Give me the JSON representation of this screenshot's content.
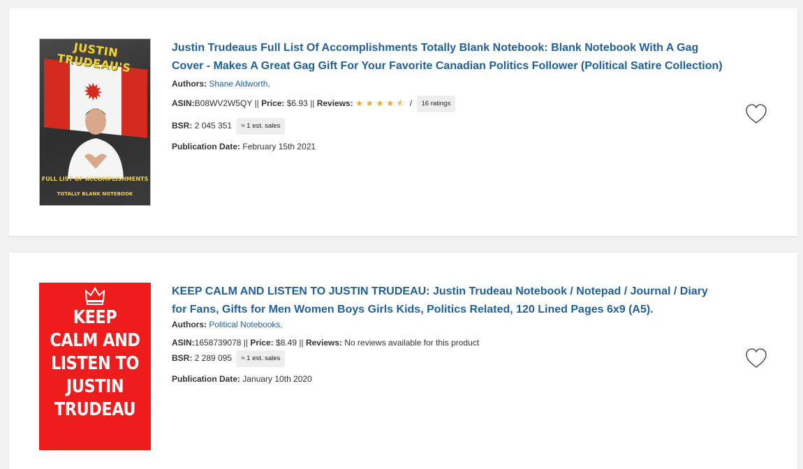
{
  "products": [
    {
      "cover_text": {
        "title": "JUSTIN TRUDEAU'S",
        "line1": "FULL LIST OF ACCOMPLISHMENTS",
        "line2": "TOTALLY BLANK NOTEBOOK"
      },
      "title": "Justin Trudeaus Full List Of Accomplishments Totally Blank Notebook: Blank Notebook With A Gag Cover - Makes A Great Gag Gift For Your Favorite Canadian Politics Follower (Political Satire Collection)",
      "authors_label": "Authors:",
      "authors": "Shane Aldworth,",
      "asin_label": "ASIN:",
      "asin": "B08WV2W5QY",
      "sep1": " || ",
      "price_label": "Price:",
      "price": "$6.93",
      "sep2": " || ",
      "reviews_label": "Reviews:",
      "rating": 4.5,
      "stars_display": "★★★★⯪",
      "slash": " /",
      "ratings_count": "16 ratings",
      "bsr_label": "BSR:",
      "bsr": "2 045 351",
      "sales_badge": "≈ 1 est. sales",
      "pub_label": "Publication Date:",
      "pub_date": "February 15th 2021"
    },
    {
      "cover_text": {
        "title": "KEEP CALM AND LISTEN TO JUSTIN TRUDEAU"
      },
      "title": "KEEP CALM AND LISTEN TO JUSTIN TRUDEAU: Justin Trudeau Notebook / Notepad / Journal / Diary for Fans, Gifts for Men Women Boys Girls Kids, Politics Related, 120 Lined Pages 6x9 (A5).",
      "authors_label": "Authors:",
      "authors": "Political Notebooks,",
      "asin_label": "ASIN:",
      "asin": "1658739078",
      "sep1": " || ",
      "price_label": "Price:",
      "price": "$8.49",
      "sep2": " || ",
      "reviews_label": "Reviews:",
      "reviews_text": "No reviews available for this product",
      "bsr_label": "BSR:",
      "bsr": "2 289 095",
      "sales_badge": "≈ 1 est. sales",
      "pub_label": "Publication Date:",
      "pub_date": "January 10th 2020"
    }
  ],
  "icons": {
    "favorite": "heart-outline-icon",
    "star": "star-icon",
    "crown": "crown-icon"
  },
  "colors": {
    "link": "#1f5f9e",
    "star": "#f2a51c",
    "cover2_bg": "#ee1c1c"
  }
}
